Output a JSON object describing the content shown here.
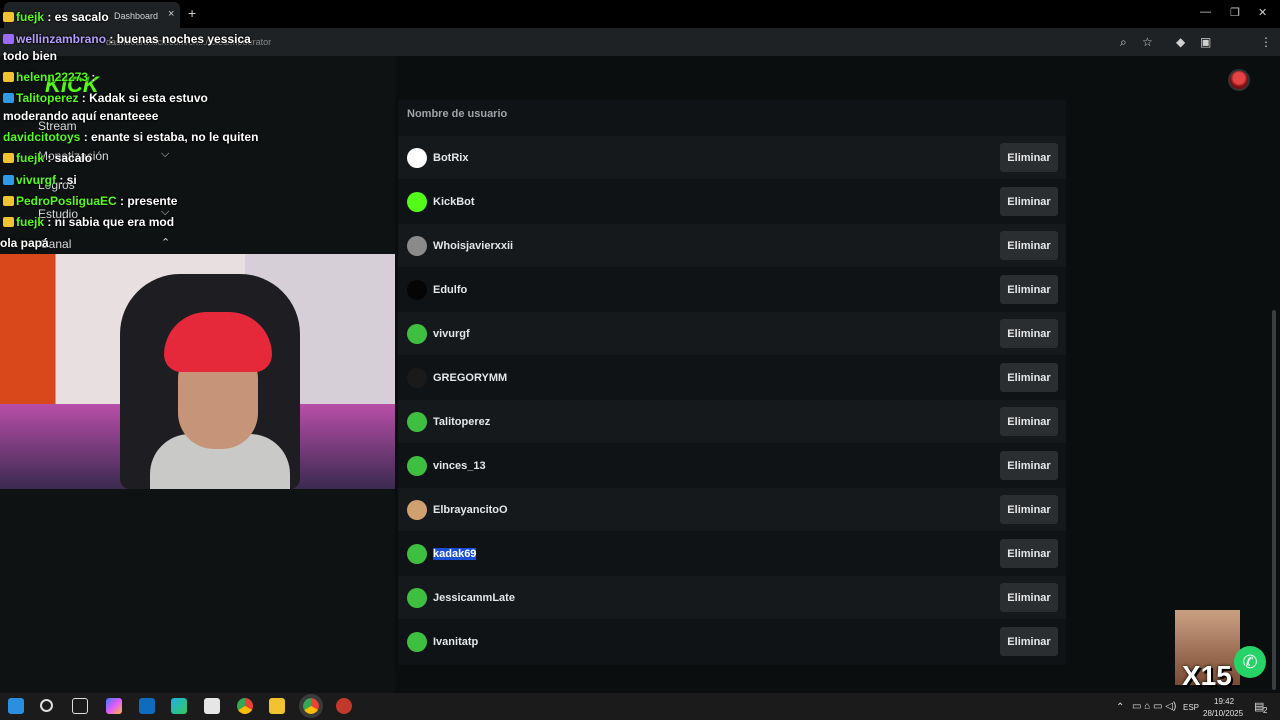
{
  "browser": {
    "tab_title": "Dashboard",
    "url": "dashboard.kick.com/ch.../roles/moderator",
    "new_tab": "+",
    "tab_close": "×",
    "min": "—",
    "max": "❐",
    "close": "✕"
  },
  "sidebar": {
    "logo": "KICK",
    "items": [
      {
        "label": "Stream"
      },
      {
        "label": "Monetización"
      },
      {
        "label": "Logros"
      },
      {
        "label": "Estudio"
      },
      {
        "label": "Canal"
      }
    ]
  },
  "chat": [
    {
      "user": "fuejk",
      "text": " : es sacalo",
      "color": "green"
    },
    {
      "user": "wellinzambrano",
      "text": " : buenas noches yessica",
      "color": "purple"
    },
    {
      "user": "",
      "text": "todo bien",
      "color": "green"
    },
    {
      "user": "helenn22273",
      "text": " : ",
      "color": "green"
    },
    {
      "user": "Talitoperez",
      "text": " : Kadak si esta estuvo",
      "color": "green"
    },
    {
      "user": "",
      "text": "moderando aquí enanteeee",
      "color": "green"
    },
    {
      "user": "davidcitotoys",
      "text": " : enante si estaba, no le quiten",
      "color": "green"
    },
    {
      "user": "fuejk",
      "text": " : sacalo",
      "color": "green"
    },
    {
      "user": "vivurgf",
      "text": " : si",
      "color": "green"
    },
    {
      "user": "PedroPosliguaEC",
      "text": " : presente",
      "color": "green"
    },
    {
      "user": "fuejk",
      "text": " : ni sabia que era mod",
      "color": "green"
    },
    {
      "user": "",
      "text": "ola papá",
      "color": "green"
    }
  ],
  "table": {
    "header": "Nombre de usuario",
    "action_label": "Eliminar",
    "rows": [
      {
        "name": "BotRix",
        "avatar_color": "#ffffff"
      },
      {
        "name": "KickBot",
        "avatar_color": "#53fc18"
      },
      {
        "name": "Whoisjavierxxii",
        "avatar_color": "#8a8a8a"
      },
      {
        "name": "Edulfo",
        "avatar_color": "#050505"
      },
      {
        "name": "vivurgf",
        "avatar_color": "#3fbf3f"
      },
      {
        "name": "GREGORYMM",
        "avatar_color": "#1a1a1a"
      },
      {
        "name": "Talitoperez",
        "avatar_color": "#3fbf3f"
      },
      {
        "name": "vinces_13",
        "avatar_color": "#3fbf3f"
      },
      {
        "name": "ElbrayancitoO",
        "avatar_color": "#d0a070"
      },
      {
        "name": "kadak69",
        "avatar_color": "#3fbf3f",
        "selected": true
      },
      {
        "name": "JessicammLate",
        "avatar_color": "#3fbf3f"
      },
      {
        "name": "Ivanitatp",
        "avatar_color": "#3fbf3f"
      }
    ]
  },
  "overlay": {
    "multiplier": "X15"
  },
  "taskbar": {
    "lang": "ESP",
    "time": "19:42",
    "date": "28/10/2025",
    "notifications": "2"
  }
}
